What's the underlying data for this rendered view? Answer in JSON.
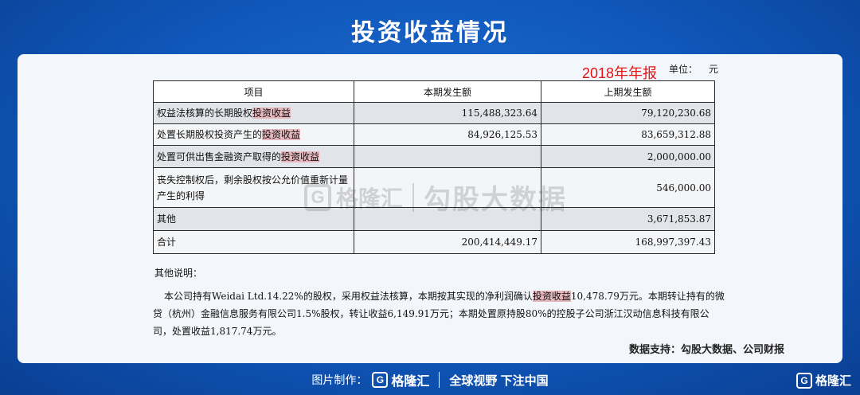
{
  "page_title": "投资收益情况",
  "report_year": "2018年年报",
  "unit_label": "单位：",
  "unit_value": "元",
  "table": {
    "headers": [
      "项目",
      "本期发生额",
      "上期发生额"
    ],
    "rows": [
      {
        "item_prefix": "权益法核算的长期股权",
        "item_highlight": "投资收益",
        "current": "115,488,323.64",
        "previous": "79,120,230.68"
      },
      {
        "item_prefix": "处置长期股权投资产生的",
        "item_highlight": "投资收益",
        "current": "84,926,125.53",
        "previous": "83,659,312.88"
      },
      {
        "item_prefix": "处置可供出售金融资产取得的",
        "item_highlight": "投资收益",
        "current": "",
        "previous": "2,000,000.00"
      },
      {
        "item_prefix": "丧失控制权后，剩余股权按公允价值重新计量产生的利得",
        "item_highlight": "",
        "current": "",
        "previous": "546,000.00"
      },
      {
        "item_prefix": "其他",
        "item_highlight": "",
        "current": "",
        "previous": "3,671,853.87"
      },
      {
        "item_prefix": "合计",
        "item_highlight": "",
        "current": "200,414,449.17",
        "previous": "168,997,397.43"
      }
    ]
  },
  "watermark": {
    "icon_glyph": "G",
    "brand": "格隆汇",
    "text": "勾股大数据"
  },
  "notes": {
    "heading": "其他说明：",
    "text_before": "本公司持有Weidai Ltd.14.22%的股权，采用权益法核算，本期按其实现的净利润确认",
    "text_highlight": "投资收益",
    "text_after": "10,478.79万元。本期转让持有的微贷（杭州）金融信息服务有限公司1.5%股权，转让收益6,149.91万元；本期处置原持股80%的控股子公司浙江汉动信息科技有限公司，处置收益1,817.74万元。"
  },
  "data_source": "数据支持：勾股大数据、公司财报",
  "footer": {
    "label": "图片制作：",
    "logo_glyph": "G",
    "logo_text": "格隆汇",
    "slogan": "全球视野 下注中国"
  },
  "corner_logo": {
    "glyph": "G",
    "text": "格隆汇"
  },
  "colors": {
    "background": "#0f56b8",
    "highlight": "#e5b7bd",
    "report_year": "#e41414"
  }
}
